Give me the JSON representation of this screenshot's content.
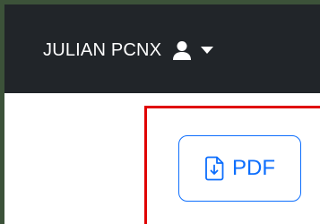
{
  "navbar": {
    "user_name": "JULIAN PCNX",
    "user_icon": "user-icon",
    "dropdown_icon": "caret-down-icon"
  },
  "content": {
    "pdf_button_label": "PDF",
    "pdf_button_icon": "file-download-icon"
  },
  "colors": {
    "navbar_bg": "#212529",
    "frame_border": "#3c5239",
    "highlight": "#e00000",
    "button_accent": "#0d6efd"
  }
}
